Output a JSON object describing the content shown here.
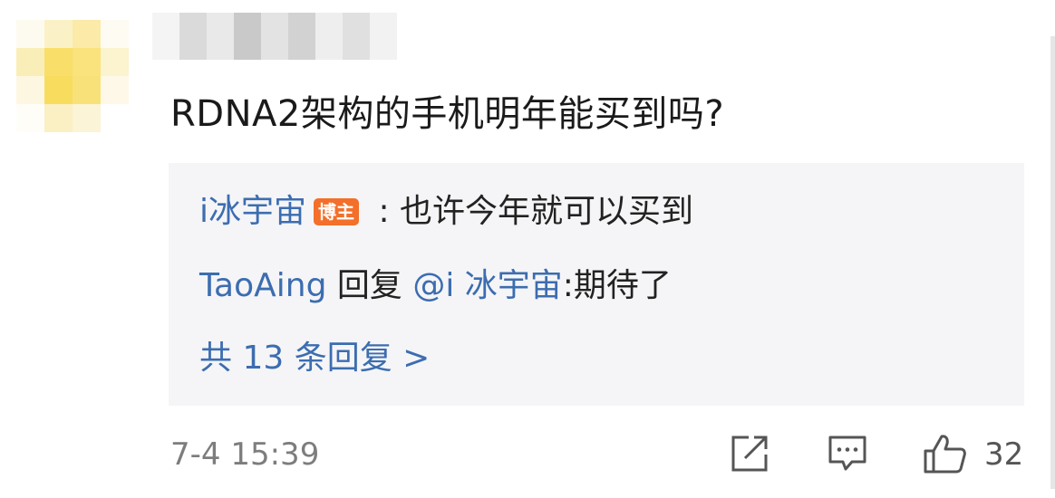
{
  "comment": {
    "text": "RDNA2架构的手机明年能买到吗?",
    "date": "7-4 15:39",
    "like_count": "32"
  },
  "replies": {
    "first": {
      "author": "i冰宇宙",
      "badge": "博主",
      "separator": " : ",
      "text": "也许今年就可以买到"
    },
    "second": {
      "author": "TaoAing",
      "reply_word": " 回复 ",
      "mention": "@i 冰宇宙",
      "text": ":期待了"
    },
    "more_label": "共 13 条回复 >"
  },
  "icons": {
    "share": "share-icon",
    "comment": "comment-icon",
    "like": "thumbs-up-icon"
  },
  "colors": {
    "link_blue": "#3c6db0",
    "badge_orange": "#f36f2a",
    "reply_bg": "#f5f5f7"
  }
}
